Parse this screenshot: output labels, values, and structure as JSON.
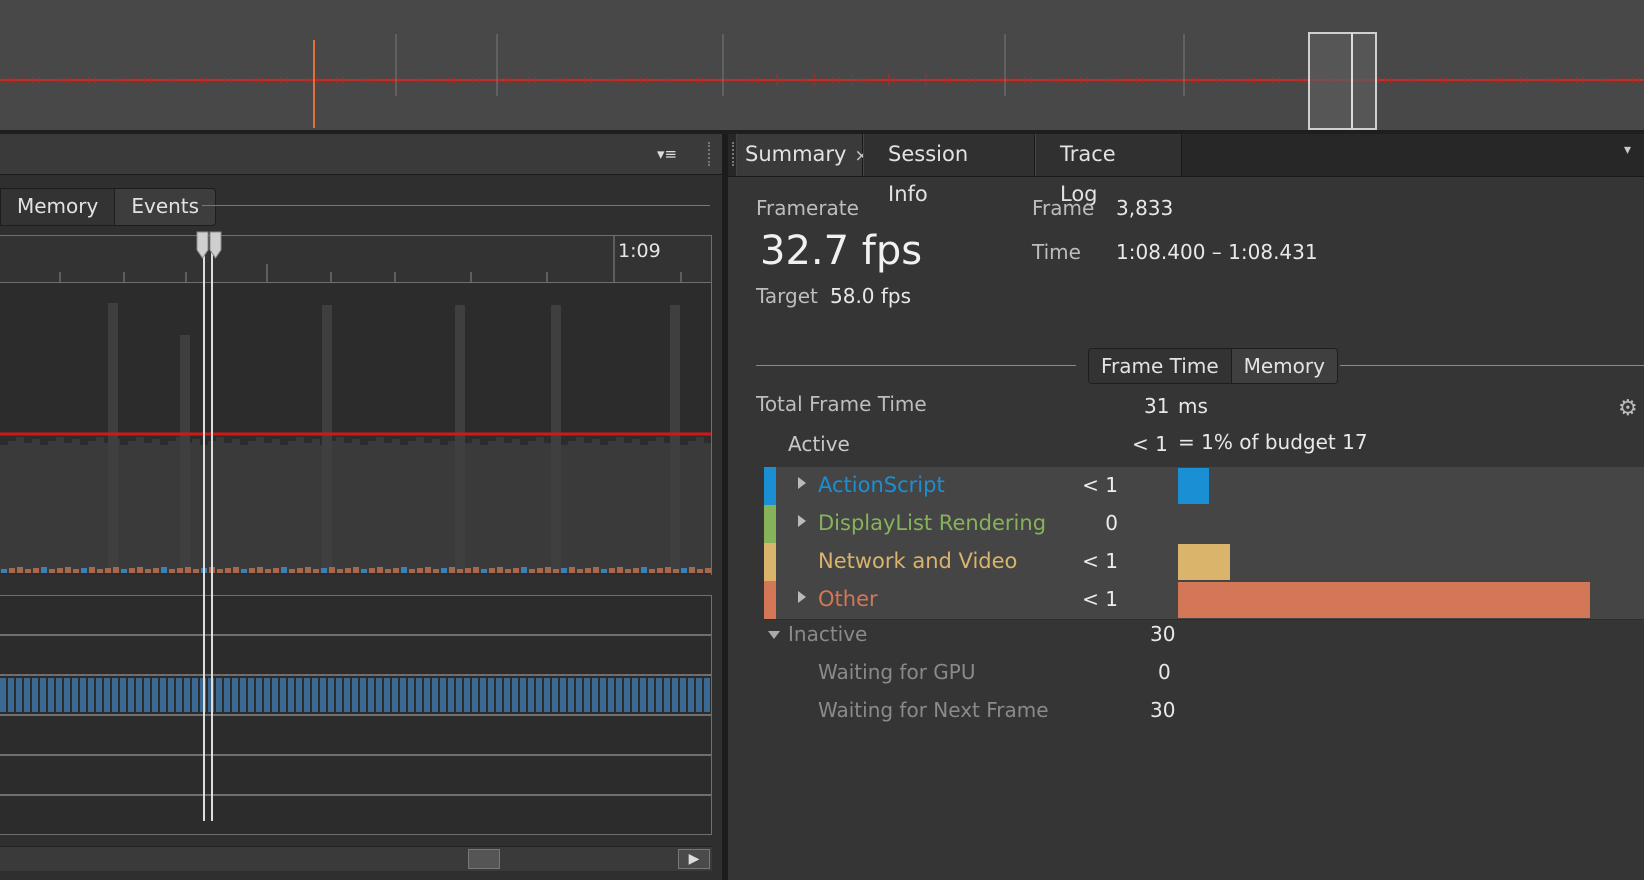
{
  "left_panel": {
    "tabs": [
      "Memory",
      "Events"
    ],
    "ruler_label": "1:09"
  },
  "right_panel": {
    "tabs": [
      {
        "label": "Summary",
        "active": true,
        "closable": true
      },
      {
        "label": "Session Info",
        "active": false
      },
      {
        "label": "Trace Log",
        "active": false
      }
    ],
    "framerate_label": "Framerate",
    "framerate_value": "32.7 fps",
    "target_label": "Target",
    "target_value": "58.0 fps",
    "frame_label": "Frame",
    "frame_value": "3,833",
    "time_label": "Time",
    "time_value": "1:08.400 – 1:08.431",
    "subtabs": [
      "Frame Time",
      "Memory"
    ],
    "total_label": "Total Frame Time",
    "total_value": "31",
    "total_unit": "ms",
    "active_label": "Active",
    "active_value": "< 1",
    "budget_text": "=  1%  of budget 17",
    "rows": [
      {
        "name": "ActionScript",
        "value": "< 1",
        "color": "#1a8fd3",
        "expandable": true,
        "share": 0.075
      },
      {
        "name": "DisplayList Rendering",
        "value": "0",
        "color": "#86b35a",
        "expandable": true,
        "share": 0
      },
      {
        "name": "Network and Video",
        "value": "< 1",
        "color": "#d9b46a",
        "expandable": false,
        "share": 0.125
      },
      {
        "name": "Other",
        "value": "< 1",
        "color": "#d47756",
        "expandable": true,
        "share": 1.0
      }
    ],
    "inactive_label": "Inactive",
    "inactive_value": "30",
    "waiting_gpu_label": "Waiting for GPU",
    "waiting_gpu_value": "0",
    "waiting_next_label": "Waiting for Next Frame",
    "waiting_next_value": "30"
  }
}
